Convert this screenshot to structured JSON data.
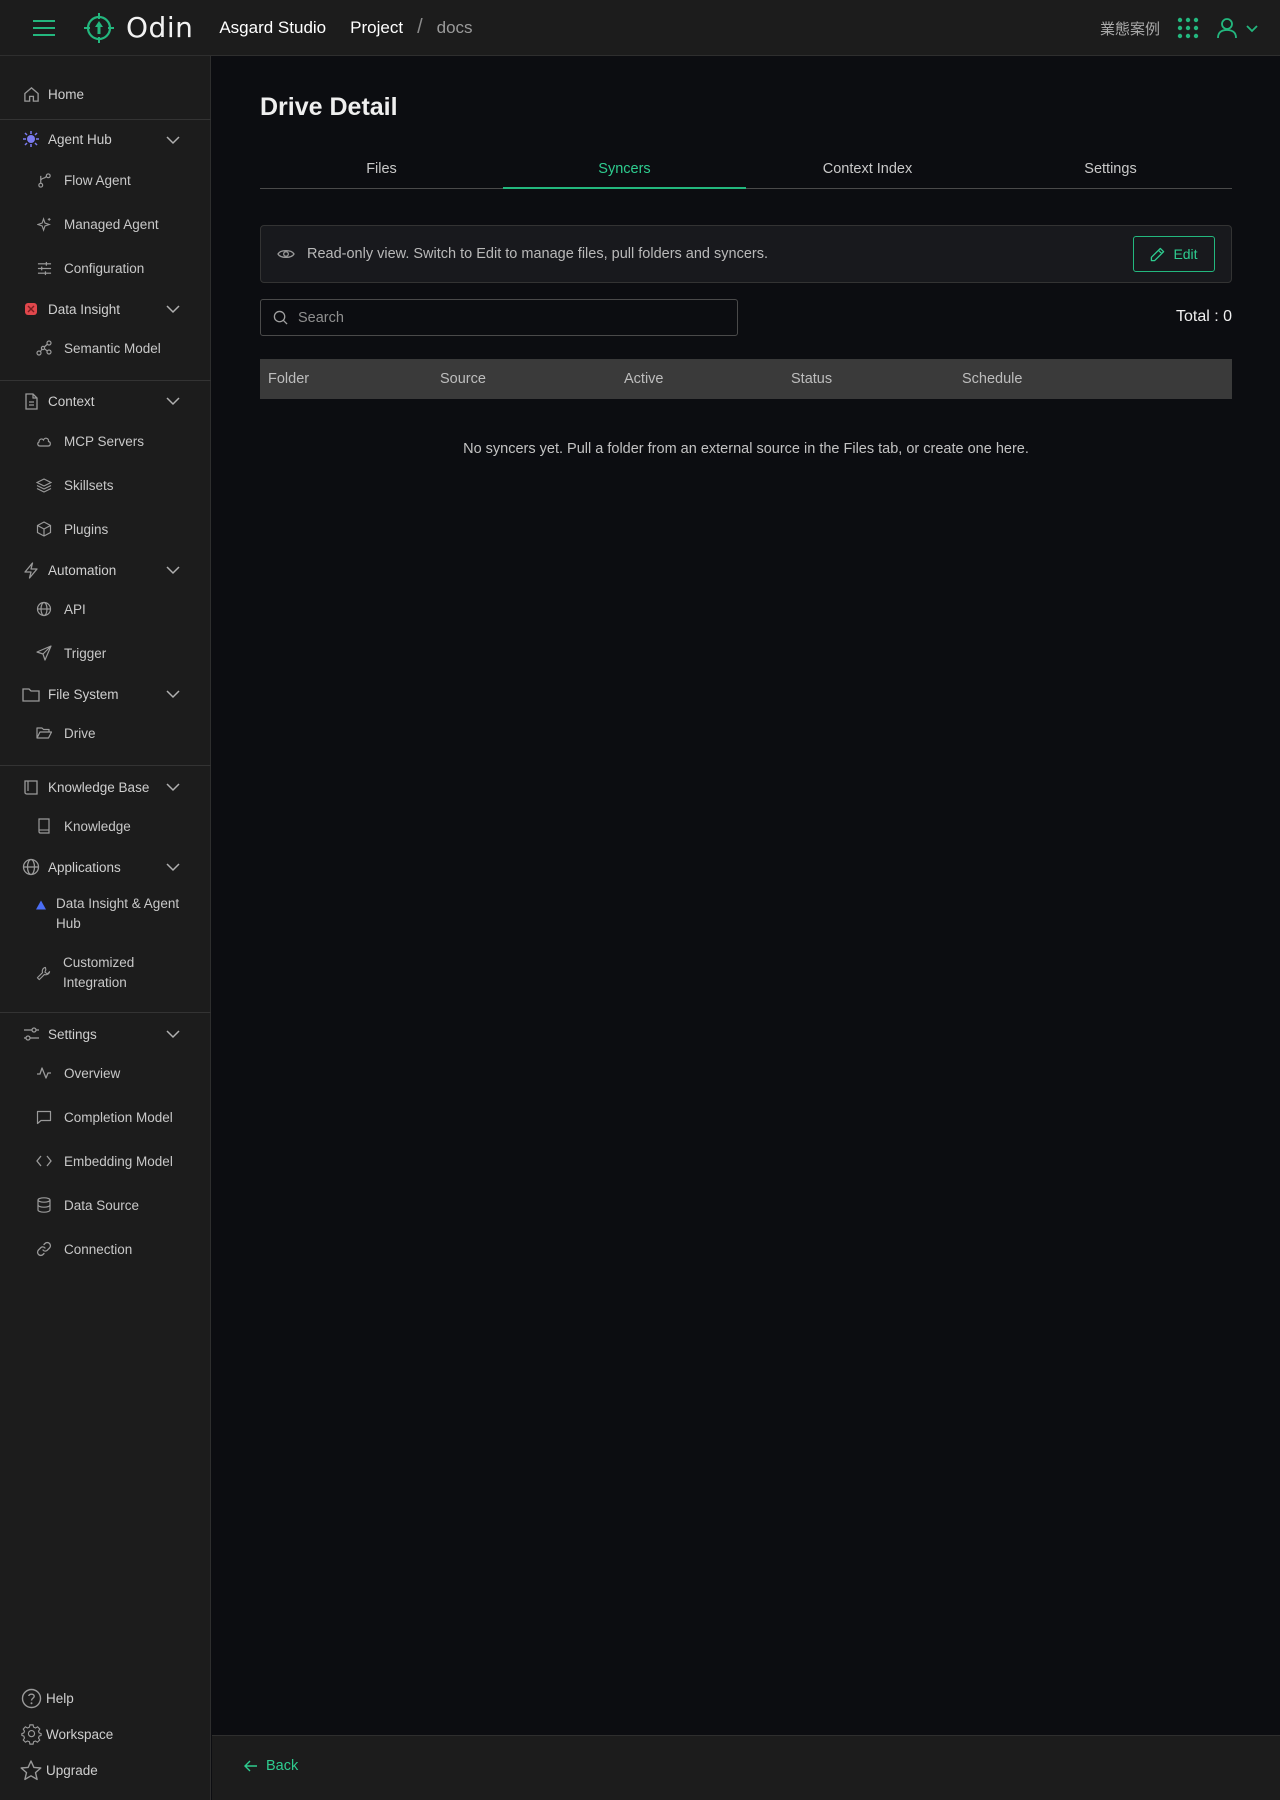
{
  "header": {
    "logo_text": "Odin",
    "studio": "Asgard Studio",
    "breadcrumb": {
      "project": "Project",
      "separator": "/",
      "current": "docs"
    },
    "lang": "業態案例"
  },
  "sidebar": {
    "home": "Home",
    "agent_hub": {
      "label": "Agent Hub",
      "items": [
        "Flow Agent",
        "Managed Agent",
        "Configuration"
      ]
    },
    "data_insight": {
      "label": "Data Insight",
      "items": [
        "Semantic Model"
      ]
    },
    "context": {
      "label": "Context",
      "items": [
        "MCP Servers",
        "Skillsets",
        "Plugins"
      ]
    },
    "automation": {
      "label": "Automation",
      "items": [
        "API",
        "Trigger"
      ]
    },
    "file_system": {
      "label": "File System",
      "items": [
        "Drive"
      ]
    },
    "knowledge_base": {
      "label": "Knowledge Base",
      "items": [
        "Knowledge"
      ]
    },
    "applications": {
      "label": "Applications",
      "items": [
        "Data Insight & Agent Hub",
        "Customized Integration"
      ]
    },
    "settings": {
      "label": "Settings",
      "items": [
        "Overview",
        "Completion Model",
        "Embedding Model",
        "Data Source",
        "Connection"
      ]
    },
    "bottom": {
      "help": "Help",
      "workspace": "Workspace",
      "upgrade": "Upgrade"
    }
  },
  "main": {
    "title": "Drive Detail",
    "tabs": [
      "Files",
      "Syncers",
      "Context Index",
      "Settings"
    ],
    "active_tab": "Syncers",
    "notice": "Read-only view. Switch to Edit to manage files, pull folders and syncers.",
    "edit_label": "Edit",
    "search_placeholder": "Search",
    "total": "Total : 0",
    "columns": [
      "Folder",
      "Source",
      "Active",
      "Status",
      "Schedule"
    ],
    "empty_message": "No syncers yet. Pull a folder from an external source in the Files tab, or create one here."
  },
  "footer": {
    "back_label": "Back"
  },
  "colors": {
    "accent": "#23b77e",
    "background": "#0c0d11",
    "panel": "#1c1c1c"
  }
}
